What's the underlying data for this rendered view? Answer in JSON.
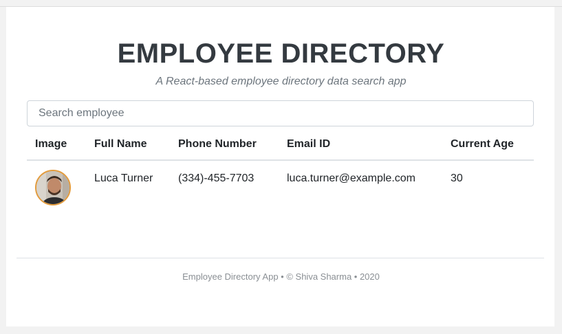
{
  "header": {
    "title": "EMPLOYEE DIRECTORY",
    "subtitle": "A React-based employee directory data search app"
  },
  "search": {
    "placeholder": "Search employee",
    "value": ""
  },
  "table": {
    "columns": [
      "Image",
      "Full Name",
      "Phone Number",
      "Email ID",
      "Current Age"
    ],
    "rows": [
      {
        "image": "avatar-photo",
        "full_name": "Luca Turner",
        "phone": "(334)-455-7703",
        "email": "luca.turner@example.com",
        "age": "30"
      }
    ]
  },
  "footer": {
    "text": "Employee Directory App • © Shiva Sharma • 2020"
  },
  "colors": {
    "title": "#343a40",
    "avatar_border": "#e39b3c",
    "page_background": "#f2f2f2"
  }
}
